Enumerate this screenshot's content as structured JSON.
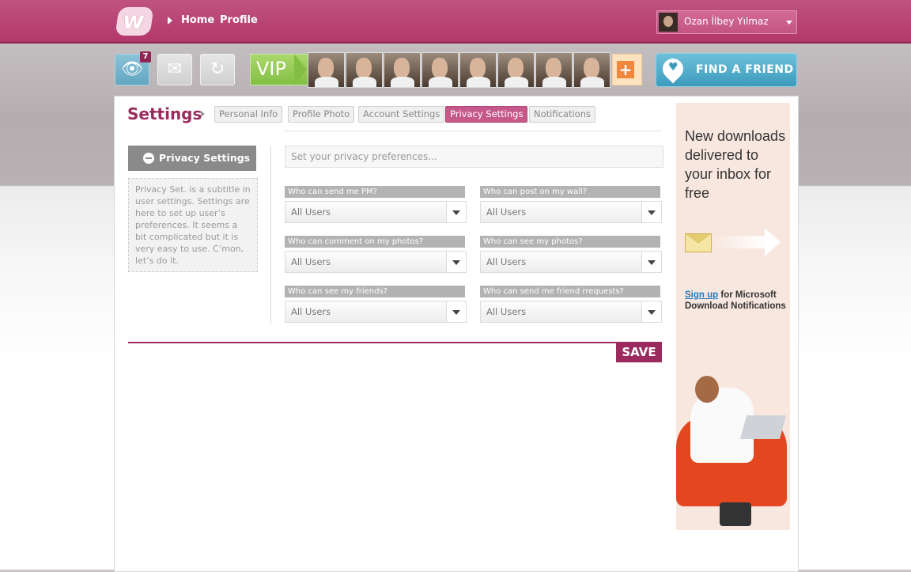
{
  "app": {
    "logo_letter": "w"
  },
  "nav": {
    "home": "Home",
    "profile": "Profile"
  },
  "user": {
    "name": "Ozan İlbey Yılmaz"
  },
  "toolbar": {
    "views_badge": "7",
    "vip_label": "VIP",
    "add_label": "+",
    "find_friend_label": "FIND A FRIEND"
  },
  "settings": {
    "title": "Settings",
    "tabs": [
      {
        "label": "Personal Info"
      },
      {
        "label": "Profile Photo"
      },
      {
        "label": "Account Settings"
      },
      {
        "label": "Privacy Settings",
        "active": true
      },
      {
        "label": "Notifications"
      }
    ]
  },
  "sidebar": {
    "title": "Privacy Settings",
    "description": "Privacy Set. is a subtitle in user settings. Settings are here to set up user’s preferences. It seems a bit complicated but it is very easy to use. C’mon, let’s do it."
  },
  "form": {
    "preferences_placeholder": "Set your privacy preferences...",
    "fields": [
      {
        "label": "Who can send me PM?",
        "value": "All Users"
      },
      {
        "label": "Who can post on my wall?",
        "value": "All Users"
      },
      {
        "label": "Who can comment on my photos?",
        "value": "All Users"
      },
      {
        "label": "Who can see my photos?",
        "value": "All Users"
      },
      {
        "label": "Who can see my friends?",
        "value": "All Users"
      },
      {
        "label": "Who can send me friend rrequests?",
        "value": "All Users"
      }
    ],
    "save_label": "SAVE"
  },
  "ad": {
    "headline": "New downloads delivered to your inbox for free",
    "signup_link": "Sign up",
    "signup_text": "for Microsoft Download Notifications"
  },
  "colors": {
    "brand": "#b2386a",
    "accent": "#9b2b5e",
    "active_tab": "#c55a8a",
    "find_friend": "#3d9bbd",
    "vip": "#84bf45"
  }
}
